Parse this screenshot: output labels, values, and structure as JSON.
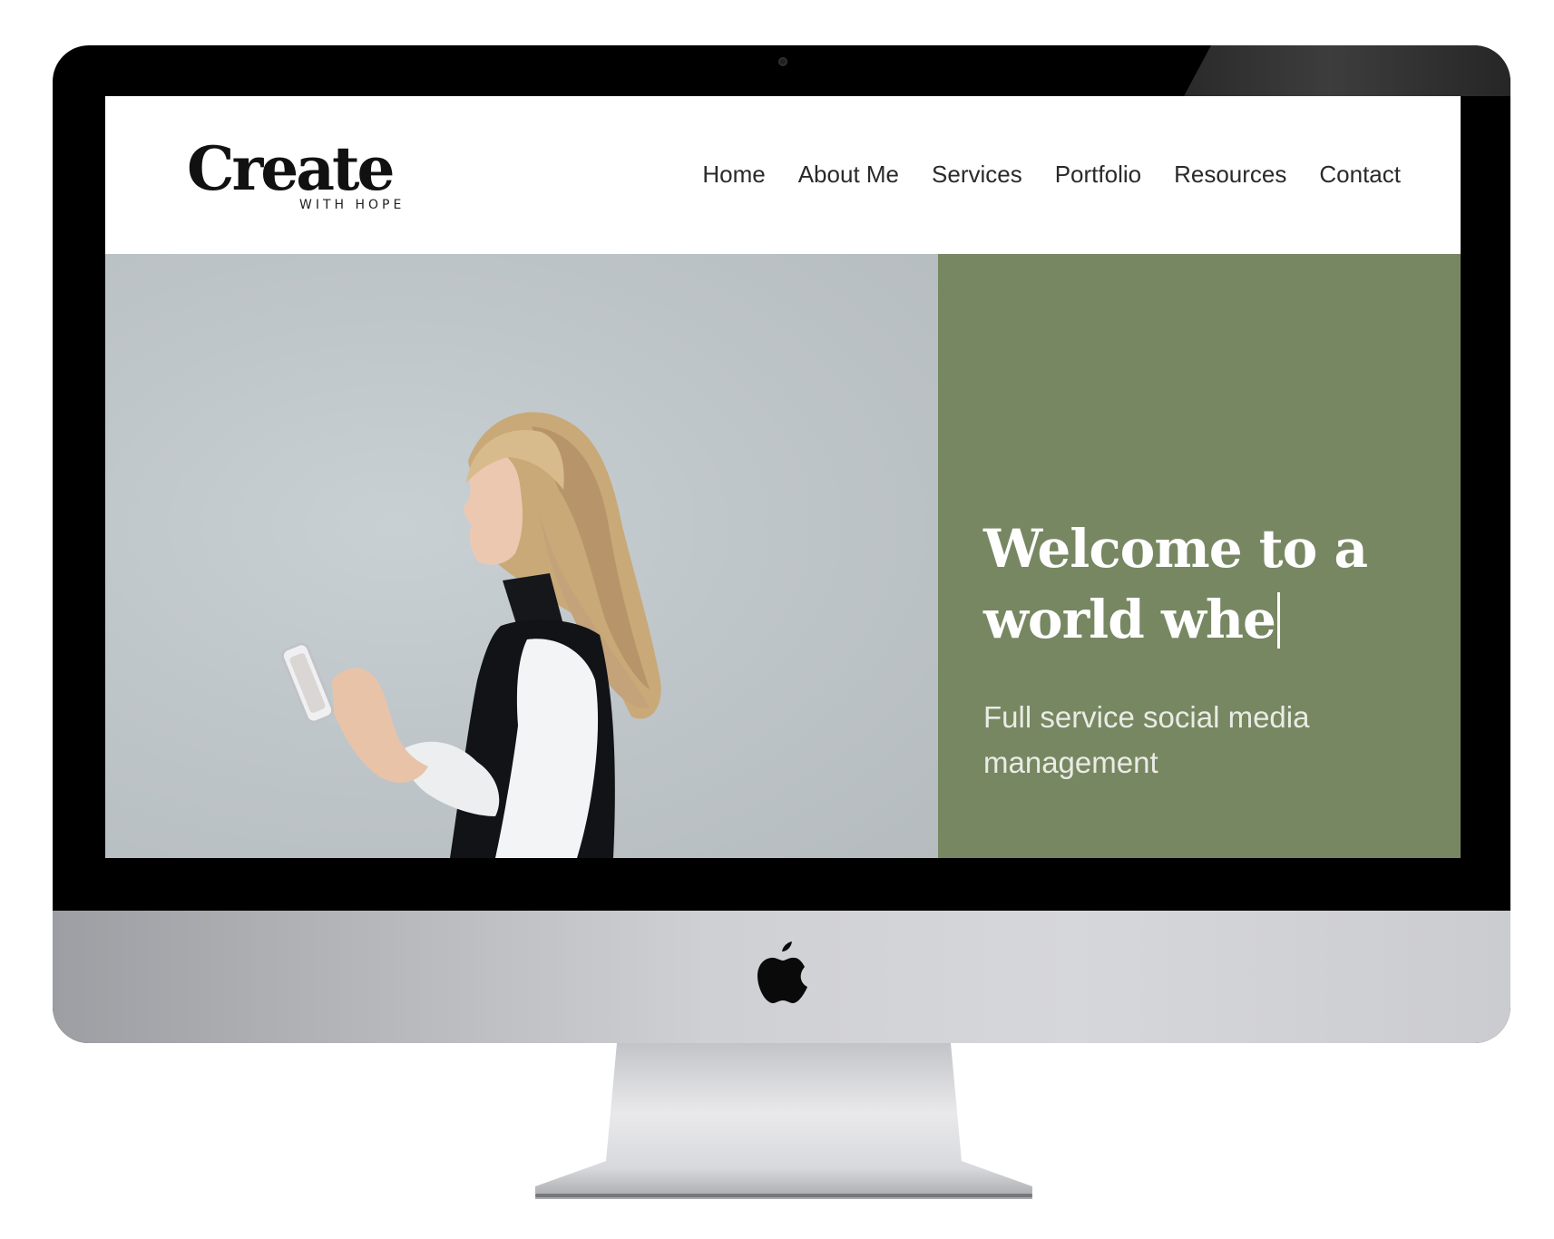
{
  "site": {
    "logo": {
      "main": "Create",
      "sub": "WITH HOPE"
    },
    "nav": [
      {
        "label": "Home"
      },
      {
        "label": "About Me"
      },
      {
        "label": "Services"
      },
      {
        "label": "Portfolio"
      },
      {
        "label": "Resources"
      },
      {
        "label": "Contact"
      }
    ],
    "hero": {
      "heading_line1": "Welcome to a",
      "heading_line2": "world whe",
      "subheading": "Full service social media management",
      "panel_color": "#778762"
    }
  },
  "device": {
    "type": "desktop monitor mockup",
    "logo_icon": "apple-logo-icon",
    "bezel_color": "#000000",
    "chin_color": "#cfd0d4"
  }
}
